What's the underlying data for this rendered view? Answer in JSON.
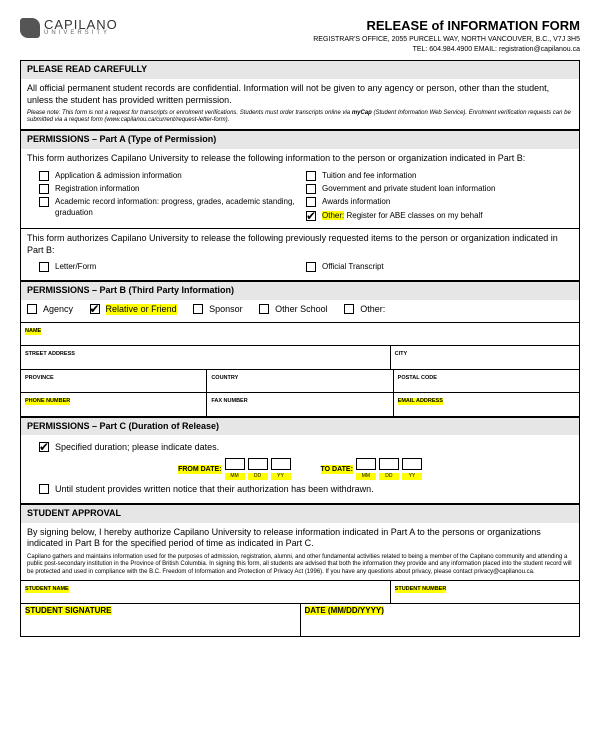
{
  "logo": {
    "name": "CAPILANO",
    "sub": "UNIVERSITY"
  },
  "header": {
    "title": "RELEASE of INFORMATION FORM",
    "addr": "REGISTRAR'S OFFICE, 2055 PURCELL WAY, NORTH VANCOUVER, B.C., V7J 3H5",
    "tel": "TEL: 604.984.4900  EMAIL: registration@capilanou.ca"
  },
  "sec_read": {
    "head": "PLEASE READ CAREFULLY",
    "p1": "All official permanent student records are confidential. Information will not be given to any agency or person, other than the student, unless the student has provided written permission.",
    "p2a": "Please note: This form is not a request for transcripts or enrolment verifications. Students must order transcripts online via ",
    "p2b": "myCap",
    "p2c": " (Student Information Web Service). Enrolment verification requests can be submitted via a request form (",
    "p2link": "www.capilanou.ca/current/request-letter-form",
    "p2d": ")."
  },
  "partA": {
    "head": "PERMISSIONS – Part A (Type of Permission)",
    "intro": "This form authorizes Capilano University to release the following information to the person or organization indicated in Part B:",
    "items": {
      "l1": "Application & admission information",
      "l2": "Registration information",
      "l3": "Academic record information: progress, grades, academic standing, graduation",
      "r1": "Tuition and fee information",
      "r2": "Government and private student loan information",
      "r3": "Awards information",
      "r4a": "Other:",
      "r4b": "Register for ABE classes on my behalf"
    },
    "prev_intro": "This form authorizes Capilano University to release the following previously requested items to the person or organization indicated in Part B:",
    "prev_l": "Letter/Form",
    "prev_r": "Official Transcript"
  },
  "partB": {
    "head": "PERMISSIONS – Part B (Third Party Information)",
    "opts": {
      "agency": "Agency",
      "relative": "Relative or Friend",
      "sponsor": "Sponsor",
      "school": "Other School",
      "other": "Other:"
    },
    "fields": {
      "name": "NAME",
      "street": "STREET ADDRESS",
      "city": "CITY",
      "province": "PROVINCE",
      "country": "COUNTRY",
      "postal": "POSTAL CODE",
      "phone": "PHONE NUMBER",
      "fax": "FAX NUMBER",
      "email": "EMAIL ADDRESS"
    }
  },
  "partC": {
    "head": "PERMISSIONS – Part C (Duration of Release)",
    "spec": "Specified duration; please indicate dates.",
    "from": "FROM DATE:",
    "to": "TO DATE:",
    "mm": "MM",
    "dd": "DD",
    "yy": "YY",
    "until": "Until student provides written notice that their authorization has been withdrawn."
  },
  "approval": {
    "head": "STUDENT APPROVAL",
    "p1": "By signing below, I hereby authorize Capilano University to release information indicated in Part A to the persons or organizations indicated in Part B for the specified period of time as indicated in Part C.",
    "p2a": "Capilano gathers and maintains information used for the purposes of admission, registration, alumni, and other fundamental activities related to being a member of the Capilano community and attending a public post-secondary institution in the Province of British Columbia. In signing this form, all students are advised that both the information they provide and any information placed into the student record will be protected and used in compliance with the B.C. Freedom of Information and Protection of Privacy Act (1996). If you have any questions about privacy, please contact ",
    "p2link": "privacy@capilanou.ca",
    "fields": {
      "sname": "STUDENT NAME",
      "snum": "STUDENT NUMBER",
      "sig": "STUDENT SIGNATURE",
      "date": "DATE (MM/DD/YYYY)"
    }
  }
}
